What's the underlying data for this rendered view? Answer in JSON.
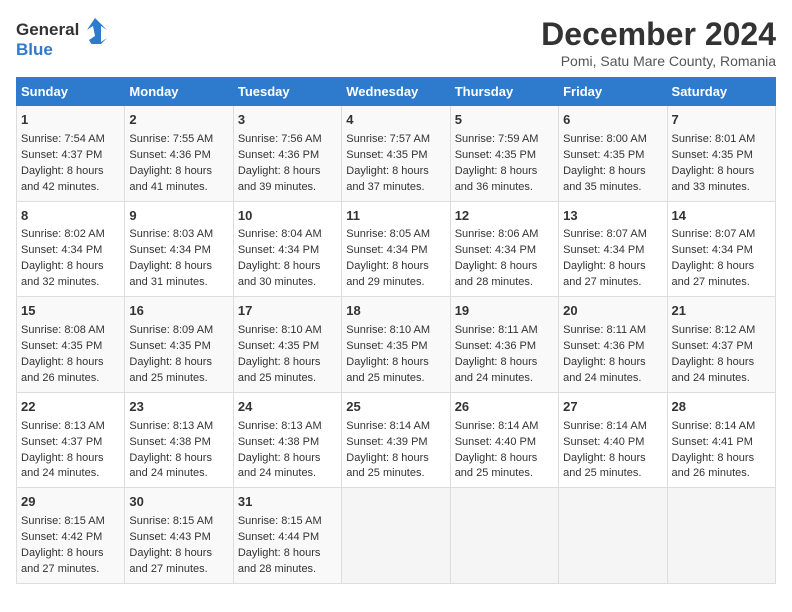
{
  "header": {
    "logo_line1": "General",
    "logo_line2": "Blue",
    "title": "December 2024",
    "subtitle": "Pomi, Satu Mare County, Romania"
  },
  "days_of_week": [
    "Sunday",
    "Monday",
    "Tuesday",
    "Wednesday",
    "Thursday",
    "Friday",
    "Saturday"
  ],
  "weeks": [
    [
      {
        "day": 1,
        "sunrise": "7:54 AM",
        "sunset": "4:37 PM",
        "daylight": "8 hours and 42 minutes."
      },
      {
        "day": 2,
        "sunrise": "7:55 AM",
        "sunset": "4:36 PM",
        "daylight": "8 hours and 41 minutes."
      },
      {
        "day": 3,
        "sunrise": "7:56 AM",
        "sunset": "4:36 PM",
        "daylight": "8 hours and 39 minutes."
      },
      {
        "day": 4,
        "sunrise": "7:57 AM",
        "sunset": "4:35 PM",
        "daylight": "8 hours and 37 minutes."
      },
      {
        "day": 5,
        "sunrise": "7:59 AM",
        "sunset": "4:35 PM",
        "daylight": "8 hours and 36 minutes."
      },
      {
        "day": 6,
        "sunrise": "8:00 AM",
        "sunset": "4:35 PM",
        "daylight": "8 hours and 35 minutes."
      },
      {
        "day": 7,
        "sunrise": "8:01 AM",
        "sunset": "4:35 PM",
        "daylight": "8 hours and 33 minutes."
      }
    ],
    [
      {
        "day": 8,
        "sunrise": "8:02 AM",
        "sunset": "4:34 PM",
        "daylight": "8 hours and 32 minutes."
      },
      {
        "day": 9,
        "sunrise": "8:03 AM",
        "sunset": "4:34 PM",
        "daylight": "8 hours and 31 minutes."
      },
      {
        "day": 10,
        "sunrise": "8:04 AM",
        "sunset": "4:34 PM",
        "daylight": "8 hours and 30 minutes."
      },
      {
        "day": 11,
        "sunrise": "8:05 AM",
        "sunset": "4:34 PM",
        "daylight": "8 hours and 29 minutes."
      },
      {
        "day": 12,
        "sunrise": "8:06 AM",
        "sunset": "4:34 PM",
        "daylight": "8 hours and 28 minutes."
      },
      {
        "day": 13,
        "sunrise": "8:07 AM",
        "sunset": "4:34 PM",
        "daylight": "8 hours and 27 minutes."
      },
      {
        "day": 14,
        "sunrise": "8:07 AM",
        "sunset": "4:34 PM",
        "daylight": "8 hours and 27 minutes."
      }
    ],
    [
      {
        "day": 15,
        "sunrise": "8:08 AM",
        "sunset": "4:35 PM",
        "daylight": "8 hours and 26 minutes."
      },
      {
        "day": 16,
        "sunrise": "8:09 AM",
        "sunset": "4:35 PM",
        "daylight": "8 hours and 25 minutes."
      },
      {
        "day": 17,
        "sunrise": "8:10 AM",
        "sunset": "4:35 PM",
        "daylight": "8 hours and 25 minutes."
      },
      {
        "day": 18,
        "sunrise": "8:10 AM",
        "sunset": "4:35 PM",
        "daylight": "8 hours and 25 minutes."
      },
      {
        "day": 19,
        "sunrise": "8:11 AM",
        "sunset": "4:36 PM",
        "daylight": "8 hours and 24 minutes."
      },
      {
        "day": 20,
        "sunrise": "8:11 AM",
        "sunset": "4:36 PM",
        "daylight": "8 hours and 24 minutes."
      },
      {
        "day": 21,
        "sunrise": "8:12 AM",
        "sunset": "4:37 PM",
        "daylight": "8 hours and 24 minutes."
      }
    ],
    [
      {
        "day": 22,
        "sunrise": "8:13 AM",
        "sunset": "4:37 PM",
        "daylight": "8 hours and 24 minutes."
      },
      {
        "day": 23,
        "sunrise": "8:13 AM",
        "sunset": "4:38 PM",
        "daylight": "8 hours and 24 minutes."
      },
      {
        "day": 24,
        "sunrise": "8:13 AM",
        "sunset": "4:38 PM",
        "daylight": "8 hours and 24 minutes."
      },
      {
        "day": 25,
        "sunrise": "8:14 AM",
        "sunset": "4:39 PM",
        "daylight": "8 hours and 25 minutes."
      },
      {
        "day": 26,
        "sunrise": "8:14 AM",
        "sunset": "4:40 PM",
        "daylight": "8 hours and 25 minutes."
      },
      {
        "day": 27,
        "sunrise": "8:14 AM",
        "sunset": "4:40 PM",
        "daylight": "8 hours and 25 minutes."
      },
      {
        "day": 28,
        "sunrise": "8:14 AM",
        "sunset": "4:41 PM",
        "daylight": "8 hours and 26 minutes."
      }
    ],
    [
      {
        "day": 29,
        "sunrise": "8:15 AM",
        "sunset": "4:42 PM",
        "daylight": "8 hours and 27 minutes."
      },
      {
        "day": 30,
        "sunrise": "8:15 AM",
        "sunset": "4:43 PM",
        "daylight": "8 hours and 27 minutes."
      },
      {
        "day": 31,
        "sunrise": "8:15 AM",
        "sunset": "4:44 PM",
        "daylight": "8 hours and 28 minutes."
      },
      null,
      null,
      null,
      null
    ]
  ]
}
